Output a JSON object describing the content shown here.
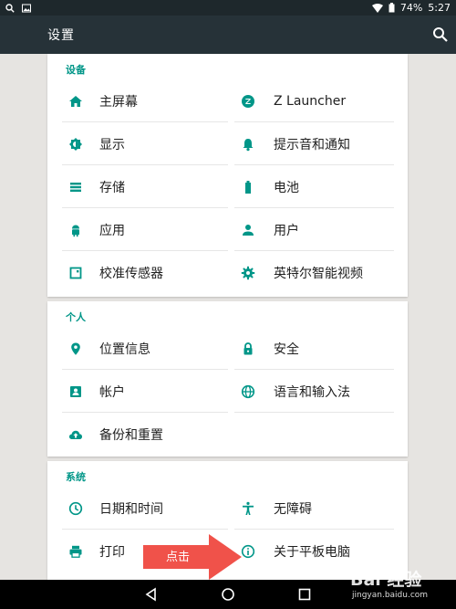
{
  "status_bar": {
    "battery": "74%",
    "time": "5:27"
  },
  "app_bar": {
    "title": "设置"
  },
  "sections": {
    "device": {
      "header": "设备",
      "items": [
        {
          "label": "主屏幕",
          "icon": "home-icon"
        },
        {
          "label": "Z Launcher",
          "icon": "z-launcher-icon"
        },
        {
          "label": "显示",
          "icon": "brightness-icon"
        },
        {
          "label": "提示音和通知",
          "icon": "bell-icon"
        },
        {
          "label": "存储",
          "icon": "storage-icon"
        },
        {
          "label": "电池",
          "icon": "battery-icon"
        },
        {
          "label": "应用",
          "icon": "android-icon"
        },
        {
          "label": "用户",
          "icon": "person-icon"
        },
        {
          "label": "校准传感器",
          "icon": "sensor-icon"
        },
        {
          "label": "英特尔智能视频",
          "icon": "gear-icon"
        }
      ]
    },
    "personal": {
      "header": "个人",
      "items": [
        {
          "label": "位置信息",
          "icon": "location-icon"
        },
        {
          "label": "安全",
          "icon": "lock-icon"
        },
        {
          "label": "帐户",
          "icon": "account-icon"
        },
        {
          "label": "语言和输入法",
          "icon": "globe-icon"
        },
        {
          "label": "备份和重置",
          "icon": "cloud-upload-icon"
        }
      ]
    },
    "system": {
      "header": "系统",
      "items": [
        {
          "label": "日期和时间",
          "icon": "clock-icon"
        },
        {
          "label": "无障碍",
          "icon": "accessibility-icon"
        },
        {
          "label": "打印",
          "icon": "print-icon"
        },
        {
          "label": "关于平板电脑",
          "icon": "info-icon"
        }
      ]
    }
  },
  "annotation": {
    "arrow_text": "点击"
  },
  "watermark": {
    "brand": "Bai 经验",
    "url": "jingyan.baidu.com"
  },
  "colors": {
    "accent": "#009688",
    "toolbar": "#263238",
    "statusbar": "#1e282c",
    "background": "#e6e4e1",
    "arrow": "#f0524a"
  }
}
